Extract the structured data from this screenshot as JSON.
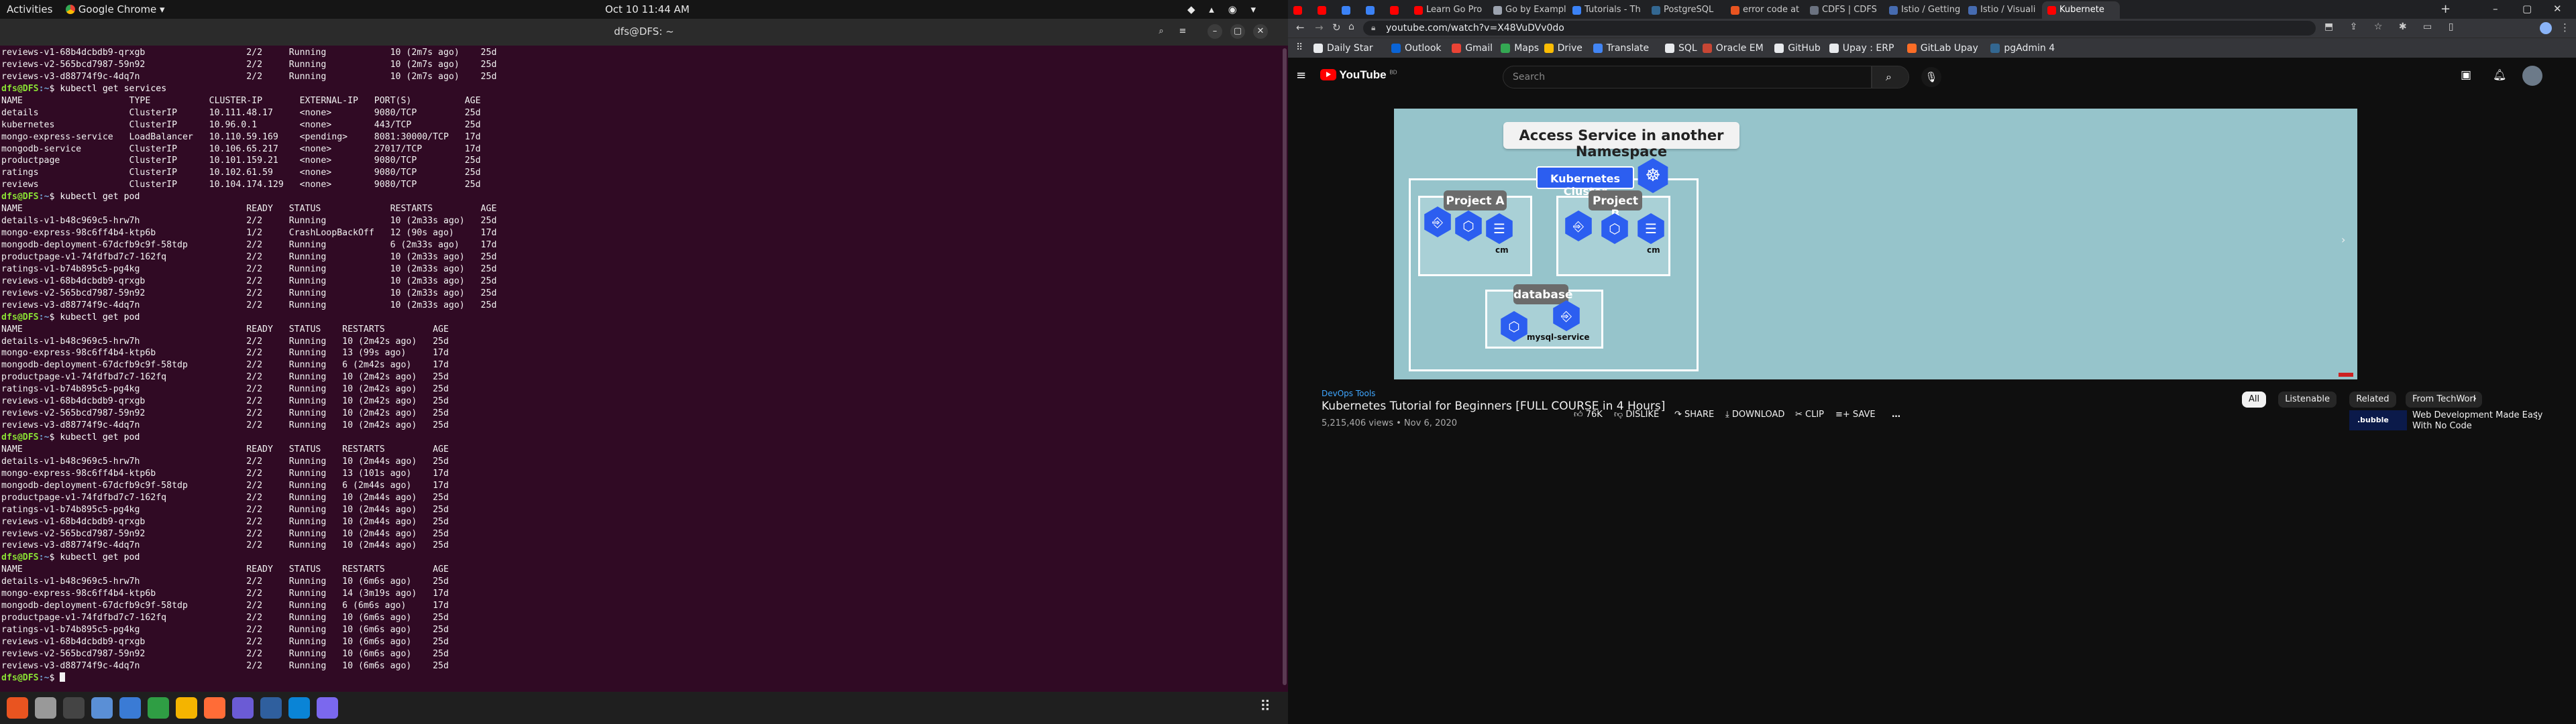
{
  "topbar": {
    "activities": "Activities",
    "app": "Google Chrome",
    "clock": "Oct 10  11:44 AM"
  },
  "terminal": {
    "title": "dfs@DFS: ~",
    "lines": [
      "reviews-v1-68b4dcbdb9-qrxgb                   2/2     Running            10 (2m7s ago)    25d",
      "reviews-v2-565bcd7987-59n92                   2/2     Running            10 (2m7s ago)    25d",
      "reviews-v3-d88774f9c-4dq7n                    2/2     Running            10 (2m7s ago)    25d",
      "$ kubectl get services",
      "NAME                    TYPE           CLUSTER-IP       EXTERNAL-IP   PORT(S)          AGE",
      "details                 ClusterIP      10.111.48.17     <none>        9080/TCP         25d",
      "kubernetes              ClusterIP      10.96.0.1        <none>        443/TCP          25d",
      "mongo-express-service   LoadBalancer   10.110.59.169    <pending>     8081:30000/TCP   17d",
      "mongodb-service         ClusterIP      10.106.65.217    <none>        27017/TCP        17d",
      "productpage             ClusterIP      10.101.159.21    <none>        9080/TCP         25d",
      "ratings                 ClusterIP      10.102.61.59     <none>        9080/TCP         25d",
      "reviews                 ClusterIP      10.104.174.129   <none>        9080/TCP         25d",
      "$ kubectl get pod",
      "NAME                                          READY   STATUS             RESTARTS         AGE",
      "details-v1-b48c969c5-hrw7h                    2/2     Running            10 (2m33s ago)   25d",
      "mongo-express-98c6ff4b4-ktp6b                 1/2     CrashLoopBackOff   12 (90s ago)     17d",
      "mongodb-deployment-67dcfb9c9f-58tdp           2/2     Running            6 (2m33s ago)    17d",
      "productpage-v1-74fdfbd7c7-162fq               2/2     Running            10 (2m33s ago)   25d",
      "ratings-v1-b74b895c5-pg4kg                    2/2     Running            10 (2m33s ago)   25d",
      "reviews-v1-68b4dcbdb9-qrxgb                   2/2     Running            10 (2m33s ago)   25d",
      "reviews-v2-565bcd7987-59n92                   2/2     Running            10 (2m33s ago)   25d",
      "reviews-v3-d88774f9c-4dq7n                    2/2     Running            10 (2m33s ago)   25d",
      "$ kubectl get pod",
      "NAME                                          READY   STATUS    RESTARTS         AGE",
      "details-v1-b48c969c5-hrw7h                    2/2     Running   10 (2m42s ago)   25d",
      "mongo-express-98c6ff4b4-ktp6b                 2/2     Running   13 (99s ago)     17d",
      "mongodb-deployment-67dcfb9c9f-58tdp           2/2     Running   6 (2m42s ago)    17d",
      "productpage-v1-74fdfbd7c7-162fq               2/2     Running   10 (2m42s ago)   25d",
      "ratings-v1-b74b895c5-pg4kg                    2/2     Running   10 (2m42s ago)   25d",
      "reviews-v1-68b4dcbdb9-qrxgb                   2/2     Running   10 (2m42s ago)   25d",
      "reviews-v2-565bcd7987-59n92                   2/2     Running   10 (2m42s ago)   25d",
      "reviews-v3-d88774f9c-4dq7n                    2/2     Running   10 (2m42s ago)   25d",
      "$ kubectl get pod",
      "NAME                                          READY   STATUS    RESTARTS         AGE",
      "details-v1-b48c969c5-hrw7h                    2/2     Running   10 (2m44s ago)   25d",
      "mongo-express-98c6ff4b4-ktp6b                 2/2     Running   13 (101s ago)    17d",
      "mongodb-deployment-67dcfb9c9f-58tdp           2/2     Running   6 (2m44s ago)    17d",
      "productpage-v1-74fdfbd7c7-162fq               2/2     Running   10 (2m44s ago)   25d",
      "ratings-v1-b74b895c5-pg4kg                    2/2     Running   10 (2m44s ago)   25d",
      "reviews-v1-68b4dcbdb9-qrxgb                   2/2     Running   10 (2m44s ago)   25d",
      "reviews-v2-565bcd7987-59n92                   2/2     Running   10 (2m44s ago)   25d",
      "reviews-v3-d88774f9c-4dq7n                    2/2     Running   10 (2m44s ago)   25d",
      "$ kubectl get pod",
      "NAME                                          READY   STATUS    RESTARTS         AGE",
      "details-v1-b48c969c5-hrw7h                    2/2     Running   10 (6m6s ago)    25d",
      "mongo-express-98c6ff4b4-ktp6b                 2/2     Running   14 (3m19s ago)   17d",
      "mongodb-deployment-67dcfb9c9f-58tdp           2/2     Running   6 (6m6s ago)     17d",
      "productpage-v1-74fdfbd7c7-162fq               2/2     Running   10 (6m6s ago)    25d",
      "ratings-v1-b74b895c5-pg4kg                    2/2     Running   10 (6m6s ago)    25d",
      "reviews-v1-68b4dcbdb9-qrxgb                   2/2     Running   10 (6m6s ago)    25d",
      "reviews-v2-565bcd7987-59n92                   2/2     Running   10 (6m6s ago)    25d",
      "reviews-v3-d88774f9c-4dq7n                    2/2     Running   10 (6m6s ago)    25d",
      "$ "
    ],
    "prompt_user": "dfs@DFS",
    "prompt_path": ":~"
  },
  "dock": {
    "apps": [
      "ubuntu-software-icon",
      "settings-icon",
      "terminal-icon",
      "files-icon",
      "text-editor-icon",
      "spreadsheet-icon",
      "chrome-icon",
      "postman-icon",
      "screenshot-icon",
      "vpn-icon",
      "vscode-icon",
      "kubernetes-icon"
    ],
    "colors": [
      "#e95420",
      "#999999",
      "#444444",
      "#5a8fd6",
      "#3a7bd5",
      "#2f9e44",
      "#f4b400",
      "#ff6c37",
      "#6b5bd5",
      "#2f5f9e",
      "#0a84d6",
      "#7b68ee"
    ]
  },
  "browser": {
    "tabs": [
      {
        "label": "",
        "color": "#ff0000"
      },
      {
        "label": "",
        "color": "#ff0000"
      },
      {
        "label": "",
        "color": "#3b82f6"
      },
      {
        "label": "",
        "color": "#3b82f6"
      },
      {
        "label": "",
        "color": "#ff0000"
      },
      {
        "label": "Learn Go Pro",
        "color": "#ff0000"
      },
      {
        "label": "Go by Example",
        "color": "#9ca3af"
      },
      {
        "label": "Tutorials - Th",
        "color": "#3b82f6"
      },
      {
        "label": "PostgreSQL",
        "color": "#336791"
      },
      {
        "label": "error code at",
        "color": "#e95420"
      },
      {
        "label": "CDFS | CDFS",
        "color": "#6b7280"
      },
      {
        "label": "Istio / Getting",
        "color": "#466bb0"
      },
      {
        "label": "Istio / Visuali",
        "color": "#466bb0"
      },
      {
        "label": "Kubernete",
        "color": "#ff0000"
      }
    ],
    "url": "youtube.com/watch?v=X48VuDVv0do",
    "bookmarks": [
      {
        "label": "Daily Star",
        "color": "#e8eaed"
      },
      {
        "label": "Outlook",
        "color": "#0a64d6"
      },
      {
        "label": "Gmail",
        "color": "#ea4335"
      },
      {
        "label": "Maps",
        "color": "#34a853"
      },
      {
        "label": "Drive",
        "color": "#fbbc04"
      },
      {
        "label": "Translate",
        "color": "#4285f4"
      },
      {
        "label": "SQL",
        "color": "#e8eaed"
      },
      {
        "label": "Oracle EM",
        "color": "#c74634"
      },
      {
        "label": "GitHub",
        "color": "#e8eaed"
      },
      {
        "label": "Upay : ERP",
        "color": "#e8eaed"
      },
      {
        "label": "GitLab Upay",
        "color": "#fc6d26"
      },
      {
        "label": "pgAdmin 4",
        "color": "#336791"
      }
    ]
  },
  "youtube": {
    "logo": "YouTube",
    "region": "BD",
    "search_placeholder": "Search",
    "slide": {
      "title": "Access Service in another Namespace",
      "cluster_label": "Kubernetes Cluster",
      "project_a": "Project A",
      "project_b": "Project B",
      "database": "database",
      "cm_a": "cm",
      "cm_b": "cm",
      "mysql_service": "mysql-service"
    },
    "channel": "DevOps Tools",
    "video_title": "Kubernetes Tutorial for Beginners [FULL COURSE in 4 Hours]",
    "meta": "5,215,406 views • Nov 6, 2020",
    "likes": "76K",
    "dislike": "DISLIKE",
    "share": "SHARE",
    "download": "DOWNLOAD",
    "clip": "CLIP",
    "save": "SAVE",
    "more": "…",
    "chips": [
      "All",
      "Listenable",
      "Related",
      "From TechWorl"
    ],
    "recommended": {
      "title_line1": "Web Development Made Easy",
      "title_line2": "With No Code",
      "thumb_text": ".bubble"
    }
  }
}
